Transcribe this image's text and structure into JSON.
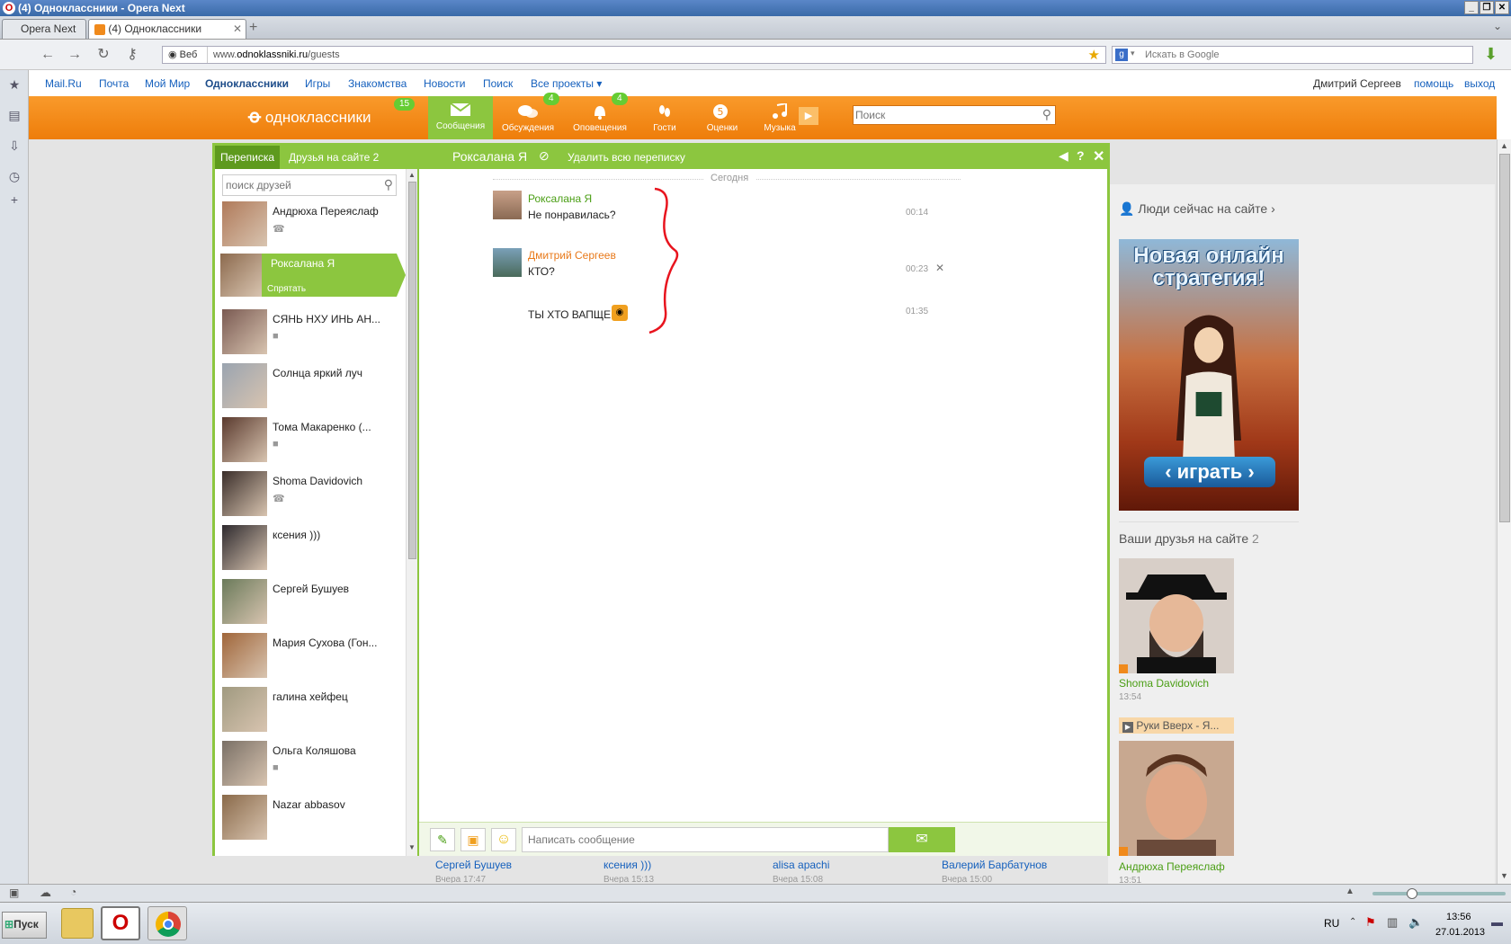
{
  "browser": {
    "window_title": "(4) Одноклассники - Opera Next",
    "tabs": [
      {
        "label": "Opera Next"
      },
      {
        "label": "(4) Одноклассники"
      }
    ],
    "web_label": "Веб",
    "url_prefix": "www.",
    "url_host": "odnoklassniki.ru",
    "url_path": "/guests",
    "search_placeholder": "Искать в Google"
  },
  "portal": {
    "links": [
      "Mail.Ru",
      "Почта",
      "Мой Мир",
      "Одноклассники",
      "Игры",
      "Знакомства",
      "Новости",
      "Поиск",
      "Все проекты"
    ],
    "user_name": "Дмитрий Сергеев",
    "help": "помощь",
    "logout": "выход"
  },
  "header": {
    "logo_text": "одноклассники",
    "logo_badge": "15",
    "nav": [
      {
        "label": "Сообщения",
        "icon": "envelope-icon",
        "badge": ""
      },
      {
        "label": "Обсуждения",
        "icon": "chat-bubbles-icon",
        "badge": "4"
      },
      {
        "label": "Оповещения",
        "icon": "bell-icon",
        "badge": "4"
      },
      {
        "label": "Гости",
        "icon": "footprints-icon",
        "badge": ""
      },
      {
        "label": "Оценки",
        "icon": "rating-5-icon",
        "badge": ""
      },
      {
        "label": "Музыка",
        "icon": "music-note-icon",
        "badge": ""
      }
    ],
    "search_placeholder": "Поиск"
  },
  "messenger": {
    "tab_conversations": "Переписка",
    "tab_friends_online": "Друзья на сайте 2",
    "chat_title": "Роксалана Я",
    "delete_all": "Удалить всю переписку",
    "search_placeholder": "поиск друзей",
    "hide_label": "Спрятать",
    "contacts": [
      {
        "name": "Андрюха Переяслаф",
        "status": "phone-icon",
        "color": "#b07a5a"
      },
      {
        "name": "Роксалана Я",
        "status": "",
        "color": "#8c6a4e"
      },
      {
        "name": "СЯНЬ НХУ ИНЬ АН...",
        "status": "camera-icon",
        "color": "#7a5a52"
      },
      {
        "name": "Солнца яркий луч",
        "status": "",
        "color": "#9aa4b0"
      },
      {
        "name": "Тома Макаренко (...",
        "status": "camera-icon",
        "color": "#5a3a2e"
      },
      {
        "name": "Shoma Davidovich",
        "status": "phone-icon",
        "color": "#3a2e2a"
      },
      {
        "name": "ксения )))",
        "status": "",
        "color": "#2e2a2e"
      },
      {
        "name": "Сергей Бушуев",
        "status": "",
        "color": "#6a7a5a"
      },
      {
        "name": "Мария Сухова (Гон...",
        "status": "",
        "color": "#a0663a"
      },
      {
        "name": "галина хейфец",
        "status": "",
        "color": "#a09a80"
      },
      {
        "name": "Ольга Коляшова",
        "status": "camera-icon",
        "color": "#7a7066"
      },
      {
        "name": "Nazar abbasov",
        "status": "",
        "color": "#8a6a4a"
      }
    ],
    "date_divider": "Сегодня",
    "messages": [
      {
        "author": "Роксалана Я",
        "text": "Не понравилась?",
        "time": "00:14"
      },
      {
        "author": "Дмитрий Сергеев",
        "text": "КТО?",
        "time": "00:23"
      },
      {
        "author": "",
        "text": "ТЫ ХТО ВАПЩЕ А",
        "time": "01:35"
      }
    ],
    "compose_placeholder": "Написать сообщение"
  },
  "right_sidebar": {
    "people_now": "Люди сейчас на сайте",
    "ad_title": "Новая онлайн стратегия!",
    "ad_button": "‹ играть ›",
    "friends_on_site": "Ваши друзья на сайте",
    "friends_count": "2",
    "friends": [
      {
        "name": "Shoma Davidovich",
        "time": "13:54",
        "status": ""
      },
      {
        "name": "Андрюха Переяслаф",
        "time": "13:51",
        "status": "Руки Вверх - Я..."
      }
    ]
  },
  "guests_strip": [
    {
      "name": "Сергей Бушуев",
      "time": "Вчера 17:47"
    },
    {
      "name": "ксения )))",
      "time": "Вчера 15:13"
    },
    {
      "name": "alisa apachi",
      "time": "Вчера 15:08"
    },
    {
      "name": "Валерий Барбатунов",
      "time": "Вчера 15:00"
    }
  ],
  "taskbar": {
    "start": "Пуск",
    "lang": "RU",
    "time": "13:56",
    "date": "27.01.2013"
  },
  "colors": {
    "ok_orange": "#f08a1c",
    "ok_green": "#8cc63f",
    "link_blue": "#1560bd",
    "author_green": "#4a9e14",
    "author_orange": "#e8791a"
  }
}
